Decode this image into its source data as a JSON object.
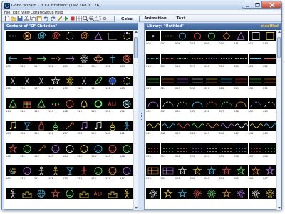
{
  "window": {
    "title": "Gobo Wizard - \"CF-Christian\" (192.168.1.126)"
  },
  "menu": [
    "File",
    "Edit",
    "View",
    "Library",
    "Setup",
    "Help"
  ],
  "tabs": [
    "Gobo",
    "Animation",
    "Text"
  ],
  "left_panel": {
    "header": "Content of \"CF-Christian\"",
    "rows": [
      {
        "labels": [],
        "icons": [
          "dots-icon",
          "rings-icon",
          "spiral-icon",
          "spiral2-icon",
          "dots-circle-icon",
          "swirl-icon",
          "triangle-icon",
          "corner-icon",
          "color-dots-icon"
        ]
      },
      {
        "labels": [
          "125",
          "126",
          "127",
          "128",
          "129",
          "130",
          "131",
          "132",
          "133"
        ],
        "icons": [
          "arrow-left-icon",
          "arrow-icon",
          "arrow-icon",
          "dots-arrow-icon",
          "arrow-right-icon",
          "sun-icon",
          "orbit-icon",
          "cross-icon",
          "rings-icon"
        ]
      },
      {
        "labels": [
          "135",
          "136",
          "137",
          "138",
          "139",
          "140",
          "141",
          "142",
          "143"
        ],
        "icons": [
          "snowflake-icon",
          "snowflake-icon",
          "snowflake-icon",
          "star-icon",
          "starburst-icon",
          "snowflake-icon",
          "leaf-icon",
          "stars-ring-icon",
          "color-dots-icon"
        ]
      },
      {
        "labels": [
          "144",
          "145",
          "146",
          "147",
          "148",
          "149",
          "150",
          "151",
          "152"
        ],
        "icons": [
          "tree-icon",
          "gift-icon",
          "tree-icon",
          "holly-icon",
          "face-icon",
          "bell-icon",
          "wreath-icon",
          "text-icon",
          "rings-icon"
        ]
      },
      {
        "labels": [
          "153",
          "154",
          "155",
          "156",
          "157",
          "158",
          "159",
          "160",
          "161"
        ],
        "icons": [
          "note-icon",
          "glass-icon",
          "bottle-icon",
          "violin-icon",
          "pen-icon",
          "note-icon",
          "note-icon",
          "guitar-icon",
          "figure-icon"
        ]
      },
      {
        "labels": [
          "160",
          "161",
          "162",
          "163",
          "164",
          "165",
          "166",
          "167",
          "168"
        ],
        "icons": [
          "star-icon",
          "face-icon",
          "pen-icon",
          "face-icon",
          "face-icon",
          "face-icon",
          "face-icon",
          "face-icon",
          "face-icon"
        ]
      },
      {
        "labels": [
          "169",
          "170",
          "171",
          "172",
          "173",
          "174",
          "175",
          "176",
          "177"
        ],
        "icons": [
          "flower-icon",
          "face-icon",
          "figure-icon",
          "figure-icon",
          "glass-icon",
          "figure-icon",
          "face-icon",
          "face-icon",
          "face-icon"
        ]
      },
      {
        "labels": [],
        "icons": [
          "figure-icon",
          "castle-icon",
          "globe-icon",
          "star-icon",
          "face-icon",
          "castle-icon",
          "text-icon",
          "castle-icon",
          "figure-icon"
        ]
      }
    ]
  },
  "right_panel": {
    "header": "Library: \"Untitled\"",
    "modified": "modified",
    "rows": [
      {
        "labels": [
          "002",
          "003",
          "006",
          "007",
          "009",
          "010",
          "011",
          "012",
          "013"
        ],
        "icons": [
          "dot-icon",
          "dots-icon",
          "ring-icon",
          "ring-icon",
          "ring-icon",
          "diamond-icon",
          "triangle-icon",
          "square-icon",
          "square-icon"
        ]
      },
      {
        "labels": [
          "014",
          "015",
          "016",
          "017",
          "018",
          "019",
          "020",
          "021",
          "022"
        ],
        "icons": [
          "dots-line-icon",
          "dots-line-icon",
          "dots-line-icon",
          "dashes-icon",
          "dashes-icon",
          "dashes-icon",
          "dashes-icon",
          "line-icon",
          "line-icon"
        ]
      },
      {
        "labels": [
          "023",
          "024",
          "025",
          "026",
          "027",
          "028",
          "029",
          "030",
          "031"
        ],
        "icons": [
          "lines-icon",
          "lines-icon",
          "lines-icon",
          "lines-icon",
          "lines-icon",
          "lines-icon",
          "lines-icon",
          "lines-icon",
          "lines-icon"
        ]
      },
      {
        "labels": [
          "032",
          "033",
          "034",
          "035",
          "036",
          "037",
          "038",
          "039",
          "040"
        ],
        "icons": [
          "arc-icon",
          "arc-icon",
          "arc-icon",
          "arc-icon",
          "arc-icon",
          "arc-icon",
          "arc-icon",
          "arc-icon",
          "arc-icon"
        ]
      },
      {
        "labels": [
          "041",
          "042",
          "043",
          "044",
          "045",
          "046",
          "047",
          "048",
          "049"
        ],
        "icons": [
          "wave-icon",
          "wave-icon",
          "wave-icon",
          "wave-icon",
          "wave-icon",
          "wave-icon",
          "wave-icon",
          "wave-icon",
          "wave-icon"
        ]
      },
      {
        "labels": [
          "050",
          "051",
          "052",
          "053",
          "054",
          "055",
          "056",
          "057",
          "058"
        ],
        "icons": [
          "dots-grid-icon",
          "dots-grid-icon",
          "dots-grid-icon",
          "dots-grid-icon",
          "dots-grid-icon",
          "dots-grid-icon",
          "dots-grid-icon",
          "dots-grid-icon",
          "dots-grid-icon"
        ]
      },
      {
        "labels": [
          "059",
          "060",
          "061",
          "062",
          "063",
          "064",
          "065",
          "066",
          "067"
        ],
        "icons": [
          "grid-icon",
          "grid-icon",
          "star-icon",
          "star-icon",
          "star-icon",
          "star-icon",
          "star-icon",
          "star-icon",
          "star-icon"
        ]
      },
      {
        "labels": [],
        "icons": [
          "burst-icon",
          "star-icon",
          "star-icon",
          "burst-icon",
          "burst-icon",
          "star-icon",
          "starburst-icon",
          "burst-icon",
          "burst-icon"
        ]
      }
    ]
  }
}
